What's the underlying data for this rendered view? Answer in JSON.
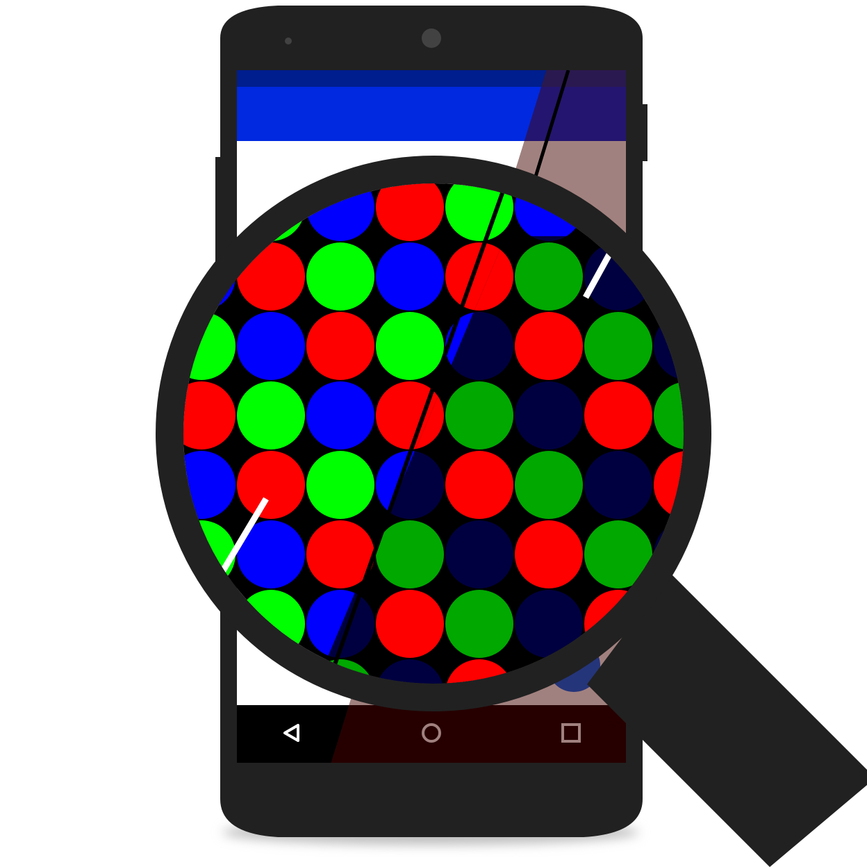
{
  "illustration": {
    "subject": "phone-with-magnifier-over-rgb-subpixels",
    "colors": {
      "background": "#ffffff",
      "phone_body": "#212121",
      "phone_shadow": "#bdbdbd",
      "camera": "#424242",
      "status_bar": "#001e8e",
      "app_bar": "#0029e0",
      "content": "#ffffff",
      "nav_bar": "#000000",
      "dim_status": "#2a1950",
      "dim_app_bar": "#241570",
      "dim_content": "#a1817f",
      "dim_nav": "#260000",
      "fab": "#25357a",
      "subpixel_red": "#ff0000",
      "subpixel_green": "#00ff00",
      "subpixel_blue": "#0000ff",
      "dim_red": "#ff0000",
      "dim_green": "#00a800",
      "dim_blue": "#000040",
      "lens_ring": "#212121",
      "handle": "#212121",
      "divider": "#000000",
      "glare": "#ffffff"
    },
    "nav_buttons": {
      "back": "back-triangle-icon",
      "home": "home-circle-icon",
      "recents": "recents-square-icon"
    }
  }
}
